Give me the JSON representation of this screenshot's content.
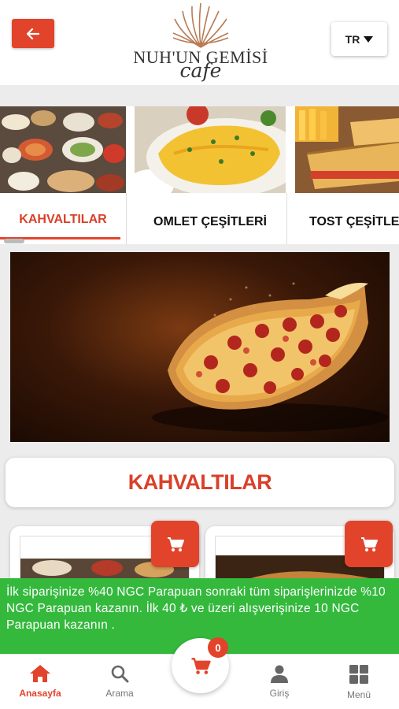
{
  "header": {
    "back_icon": "arrow-left-icon",
    "logo_name": "NUH'UN GEMİSİ",
    "logo_sub": "cafe",
    "language": "TR"
  },
  "categories": [
    {
      "label": "KAHVALTILAR",
      "active": true
    },
    {
      "label": "OMLET ÇEŞİTLERİ",
      "active": false
    },
    {
      "label": "TOST ÇEŞİTLE",
      "active": false
    }
  ],
  "section": {
    "title": "KAHVALTILAR"
  },
  "promo": {
    "text": "İlk siparişinize %40 NGC Parapuan sonraki tüm siparişlerinizde %10 NGC Parapuan kazanın. İlk 40 ₺ ve üzeri alışverişinize 10 NGC Parapuan kazanın ."
  },
  "cart": {
    "count": "0"
  },
  "nav": {
    "home": "Anasayfa",
    "search": "Arama",
    "login": "Giriş",
    "menu": "Menü"
  },
  "colors": {
    "accent": "#e2442b",
    "promo": "#34b93d"
  }
}
